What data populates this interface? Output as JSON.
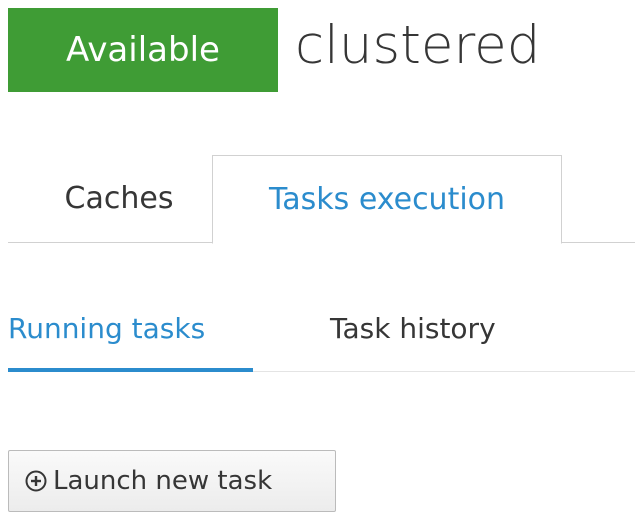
{
  "header": {
    "status": "Available",
    "cluster_name": "clustered"
  },
  "primary_tabs": [
    {
      "label": "Caches",
      "active": false
    },
    {
      "label": "Tasks execution",
      "active": true
    }
  ],
  "secondary_tabs": [
    {
      "label": "Running tasks",
      "active": true
    },
    {
      "label": "Task history",
      "active": false
    }
  ],
  "actions": {
    "launch_label": "Launch new task",
    "launch_icon": "plus-circle-icon"
  },
  "colors": {
    "status_available": "#3f9c35",
    "accent": "#2b8ccd",
    "text": "#363636"
  }
}
